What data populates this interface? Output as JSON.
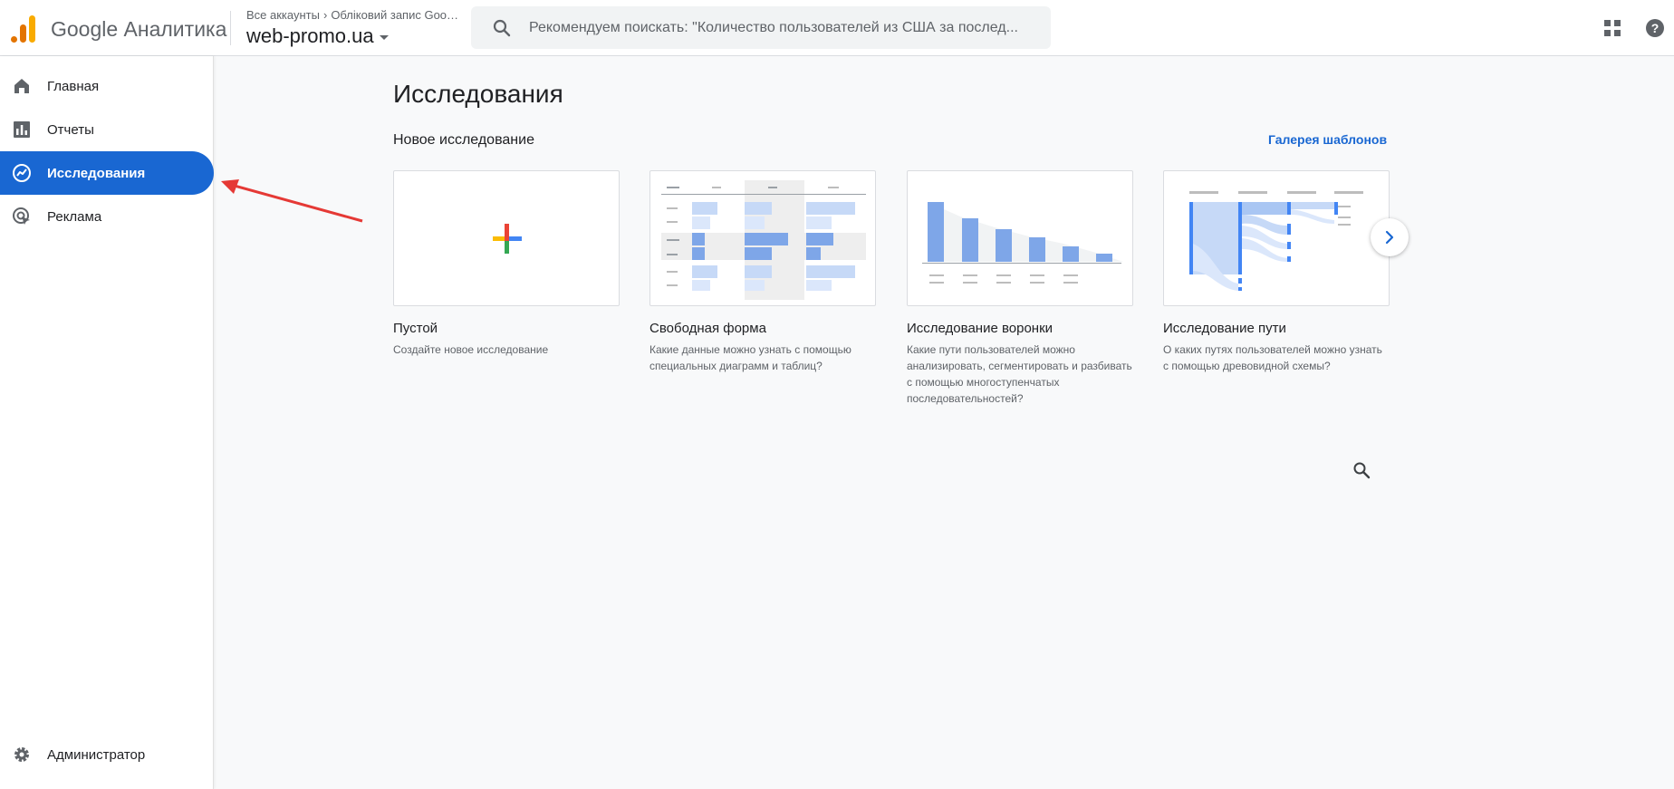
{
  "header": {
    "brand": "Google Аналитика",
    "breadcrumb": {
      "all_accounts": "Все аккаунты",
      "account": "Обліковий запис Goog..."
    },
    "property": "web-promo.ua",
    "search_placeholder": "Рекомендуем поискать: \"Количество пользователей из США за послед..."
  },
  "sidebar": {
    "items": [
      {
        "label": "Главная",
        "icon": "home-icon"
      },
      {
        "label": "Отчеты",
        "icon": "bar-chart-icon"
      },
      {
        "label": "Исследования",
        "icon": "explore-icon",
        "active": true
      },
      {
        "label": "Реклама",
        "icon": "advertising-icon"
      }
    ],
    "admin": {
      "label": "Администратор",
      "icon": "gear-icon"
    }
  },
  "main": {
    "title": "Исследования",
    "section_title": "Новое исследование",
    "gallery_link": "Галерея шаблонов",
    "cards": [
      {
        "title": "Пустой",
        "desc": "Создайте новое исследование"
      },
      {
        "title": "Свободная форма",
        "desc": "Какие данные можно узнать с помощью специальных диаграмм и таблиц?"
      },
      {
        "title": "Исследование воронки",
        "desc": "Какие пути пользователей можно анализировать, сегментировать и разбивать с помощью многоступенчатых последовательностей?"
      },
      {
        "title": "Исследование пути",
        "desc": "О каких путях пользователей можно узнать с помощью древовидной схемы?"
      }
    ]
  },
  "colors": {
    "accent": "#1967d2",
    "annotation": "#e53935"
  }
}
